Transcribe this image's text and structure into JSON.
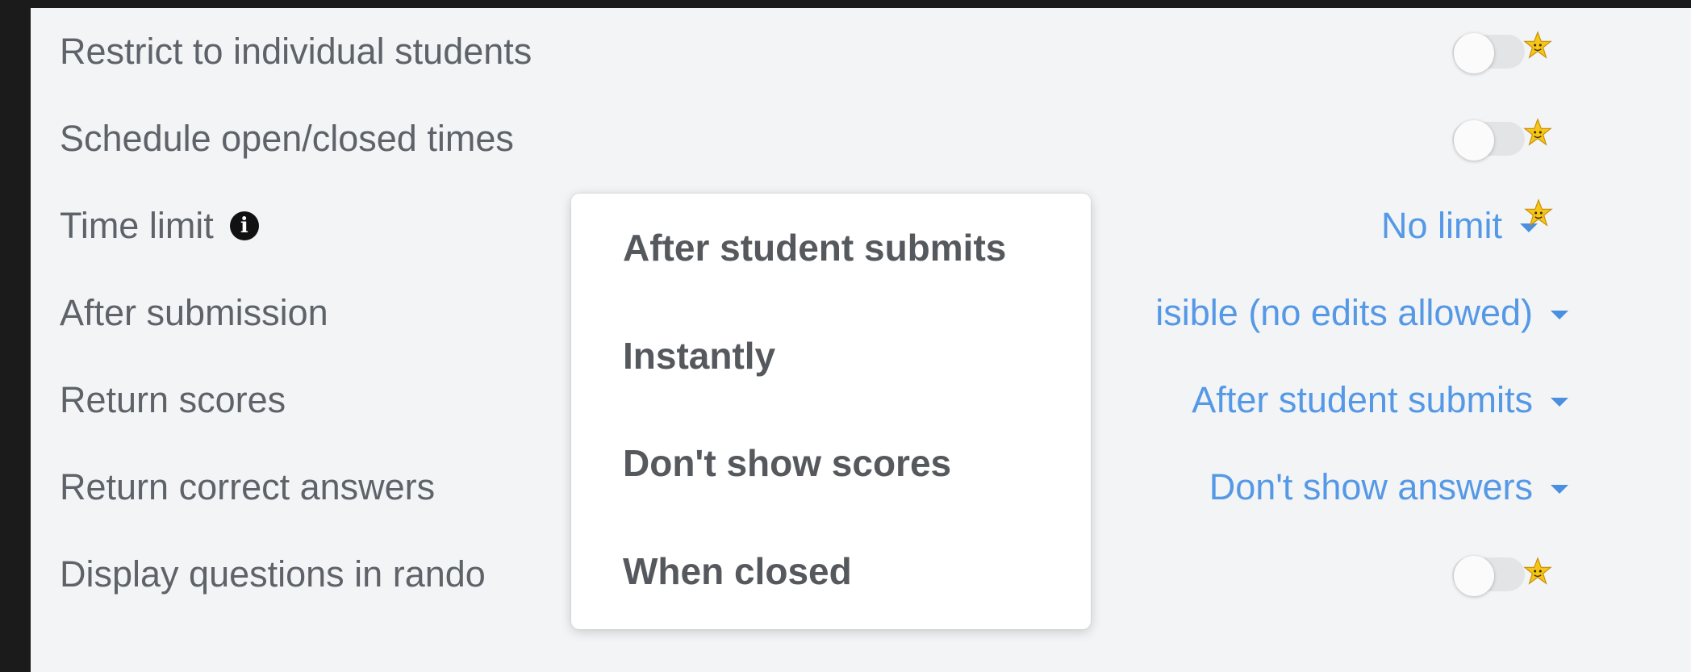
{
  "settings": {
    "restrict": {
      "label": "Restrict to individual students",
      "toggle_on": false
    },
    "schedule": {
      "label": "Schedule open/closed times",
      "toggle_on": false
    },
    "time_limit": {
      "label": "Time limit",
      "info_icon": "info-icon",
      "value": "No limit"
    },
    "after_submission": {
      "label": "After submission",
      "value": "isible (no edits allowed)"
    },
    "return_scores": {
      "label": "Return scores",
      "value": "After student submits"
    },
    "return_answers": {
      "label": "Return correct answers",
      "value": "Don't show answers"
    },
    "random_order": {
      "label": "Display questions in rando",
      "toggle_on": false
    }
  },
  "dropdown": {
    "options": [
      "After student submits",
      "Instantly",
      "Don't show scores",
      "When closed"
    ]
  },
  "icons": {
    "premium_badge": "star-badge-icon",
    "caret": "caret-down-icon",
    "info": "info-icon"
  },
  "colors": {
    "background": "#1b1b1b",
    "panel": "#f3f4f6",
    "label_text": "#5e6369",
    "accent_blue": "#5599e6",
    "star": "#f5c518"
  }
}
